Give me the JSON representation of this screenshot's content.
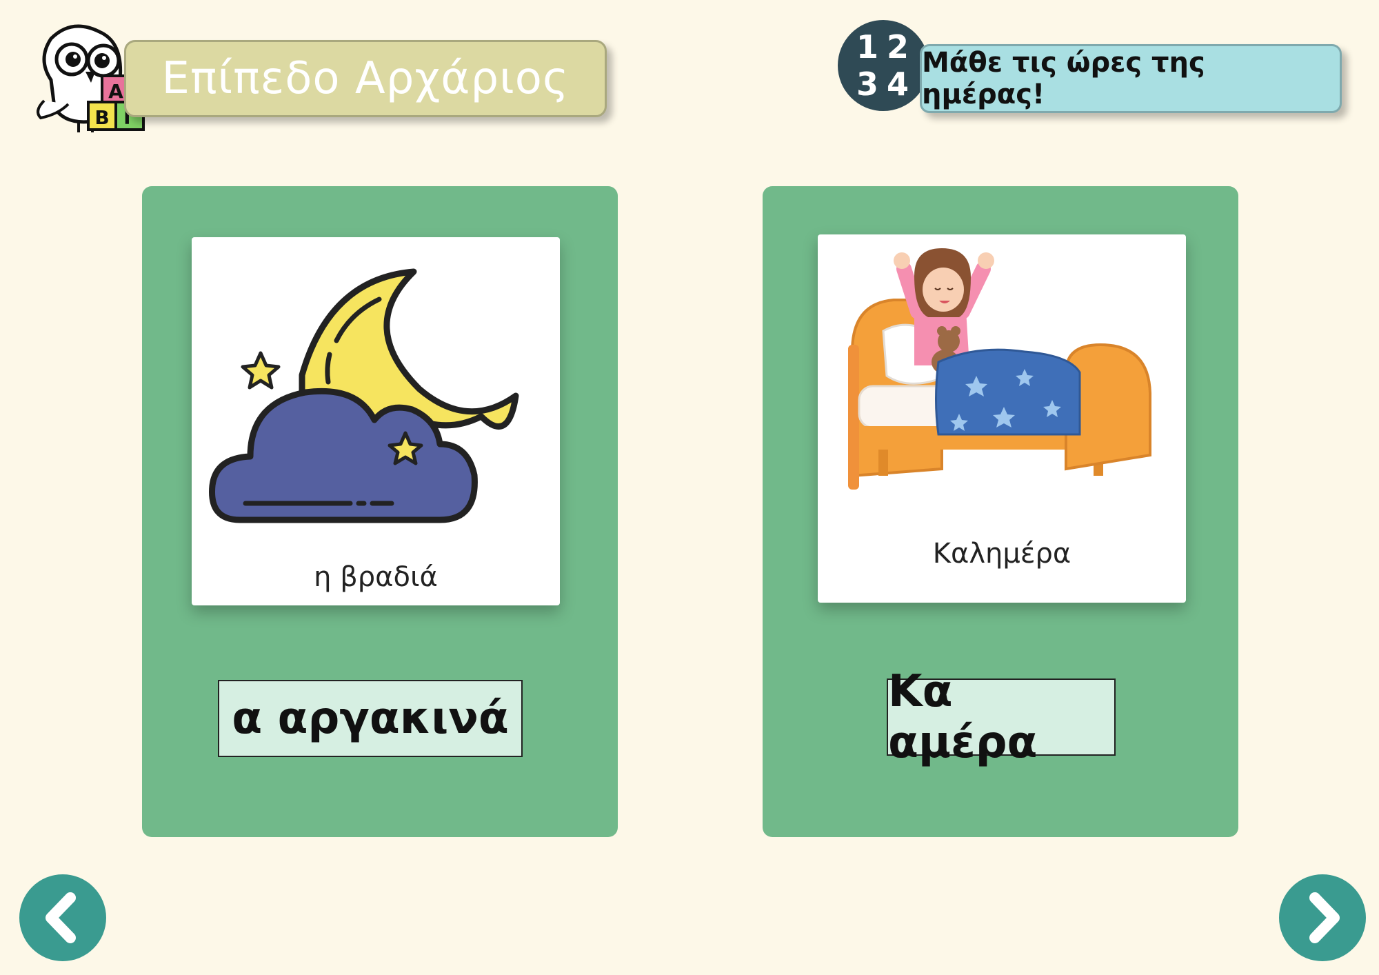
{
  "header": {
    "level_title": "Επίπεδο Αρχάριος",
    "lesson_title": "Μάθε τις ώρες της ημέρας!",
    "logo_blocks": [
      "A",
      "B",
      "Γ"
    ],
    "clock_badge_digits": [
      "1",
      "2",
      "3",
      "4"
    ]
  },
  "cards": [
    {
      "illustration": "moon-cloud-night",
      "caption": "η βραδιά",
      "answer": "α αργακινά"
    },
    {
      "illustration": "girl-waking-in-bed",
      "caption": "Καλημέρα",
      "answer": "Κα αμέρα"
    }
  ],
  "navigation": {
    "previous_icon": "chevron-left-icon",
    "next_icon": "chevron-right-icon"
  },
  "colors": {
    "background": "#fdf8e8",
    "card": "#71b98a",
    "answer_box": "#d6efe2",
    "level_banner": "#dcd9a2",
    "lesson_banner": "#a9dfe2",
    "nav_button": "#3a9b90"
  }
}
